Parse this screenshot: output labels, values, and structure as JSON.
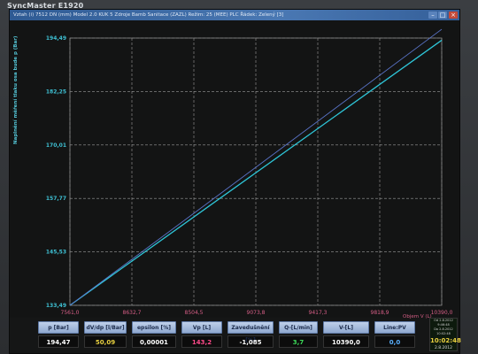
{
  "monitor": {
    "brand": "SyncMaster E1920"
  },
  "window": {
    "title": "Vztah (i) 7512 DN (mm)   Model 2.0 KUK 5 Zdroje Bamb Sanitace (ZAZL)   Režim: 25 (MEE) PLC Řádek: Zelený  [3]"
  },
  "plot": {
    "y_axis_label": "Naplnění měření tlaku osa bude   p (Bar)",
    "x_right_label": "Objem   V (L)",
    "colors": {
      "bg": "#131414",
      "grid": "#c8c8c8",
      "line1": "#2ec6d8",
      "line2": "#5a74c8",
      "ytick": "#3ec0d3",
      "xtick": "#d65e86"
    }
  },
  "chart_data": {
    "type": "line",
    "title": "",
    "xlabel": "Objem V (L)",
    "ylabel": "p (Bar)",
    "x_ticks": [
      "7561,0",
      "8632,7",
      "8504,5",
      "9073,8",
      "9417,3",
      "9818,9",
      "10390,0"
    ],
    "y_ticks": [
      "133,49",
      "145,53",
      "157,77",
      "170,01",
      "182,25",
      "194,49"
    ],
    "xlim": [
      7561.0,
      10390.0
    ],
    "ylim": [
      133.49,
      194.49
    ],
    "grid": true,
    "series": [
      {
        "x": [
          7561.0,
          10390.0
        ],
        "y": [
          133.49,
          194.0
        ]
      },
      {
        "x": [
          7561.0,
          10390.0
        ],
        "y": [
          133.49,
          196.5
        ]
      }
    ]
  },
  "readouts": [
    {
      "label": "p [Bar]",
      "value": "194,47",
      "color": "#ffffff"
    },
    {
      "label": "dV/dp [l/Bar]",
      "value": "50,09",
      "color": "#e8d040"
    },
    {
      "label": "epsilon [%]",
      "value": "0,00001",
      "color": "#ffffff"
    },
    {
      "label": "Vp [L]",
      "value": "143,2",
      "color": "#ff4a8a"
    },
    {
      "label": "Zavedušnění [%]",
      "value": "-1,085",
      "color": "#ffffff"
    },
    {
      "label": "Q-[L/min]",
      "value": "3,7",
      "color": "#3ddc5a"
    },
    {
      "label": "V-[L]",
      "value": "10390,0",
      "color": "#ffffff"
    },
    {
      "label": "Line:PV",
      "value": "0,0",
      "color": "#5ab0ff"
    }
  ],
  "status": {
    "range_from": "Od 2.8.2012 9:46:48",
    "range_to": "Do 2.8.2012 10:02:48",
    "time": "10:02:48",
    "date": "2.8.2012"
  }
}
